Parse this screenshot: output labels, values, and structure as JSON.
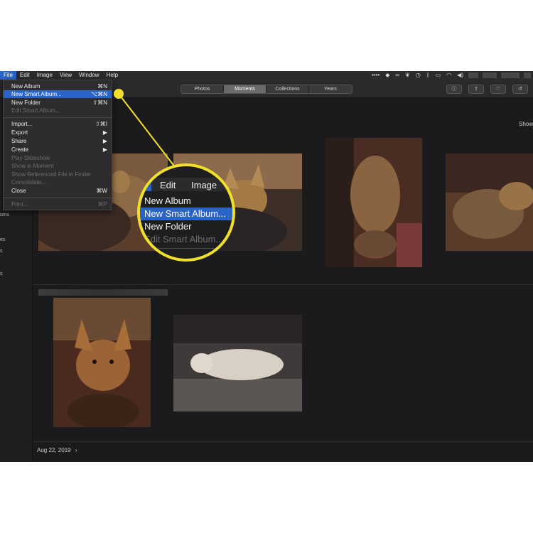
{
  "menubar": {
    "items": [
      "File",
      "Edit",
      "Image",
      "View",
      "Window",
      "Help"
    ],
    "active": "File",
    "status_icons": [
      "dots-icon",
      "dropbox-icon",
      "creative-cloud-icon",
      "evernote-icon",
      "time-machine-icon",
      "bluetooth-icon",
      "airplay-icon",
      "wifi-icon",
      "volume-icon"
    ]
  },
  "toolbar": {
    "segments": [
      "Photos",
      "Moments",
      "Collections",
      "Years"
    ],
    "selected_segment": "Moments",
    "buttons": [
      "info-icon",
      "share-icon",
      "heart-icon",
      "rotate-icon"
    ]
  },
  "file_menu": {
    "items": [
      {
        "label": "New Album",
        "shortcut": "⌘N",
        "state": "normal"
      },
      {
        "label": "New Smart Album...",
        "shortcut": "⌥⌘N",
        "state": "highlighted"
      },
      {
        "label": "New Folder",
        "shortcut": "⇧⌘N",
        "state": "normal"
      },
      {
        "label": "Edit Smart Album...",
        "shortcut": "",
        "state": "disabled"
      },
      {
        "label": "Import...",
        "shortcut": "⇧⌘I",
        "state": "normal"
      },
      {
        "label": "Export",
        "shortcut": "▶",
        "state": "normal"
      },
      {
        "label": "Share",
        "shortcut": "▶",
        "state": "normal"
      },
      {
        "label": "Create",
        "shortcut": "▶",
        "state": "normal"
      },
      {
        "label": "Play Slideshow",
        "shortcut": "",
        "state": "disabled"
      },
      {
        "label": "Show in Moment",
        "shortcut": "",
        "state": "disabled"
      },
      {
        "label": "Show Referenced File in Finder",
        "shortcut": "",
        "state": "disabled"
      },
      {
        "label": "Consolidate...",
        "shortcut": "",
        "state": "disabled"
      },
      {
        "label": "Close",
        "shortcut": "⌘W",
        "state": "normal"
      },
      {
        "label": "Print...",
        "shortcut": "⌘P",
        "state": "disabled"
      }
    ]
  },
  "magnifier": {
    "bar": [
      "Edit",
      "Image"
    ],
    "items": [
      {
        "label": "New Album",
        "state": "normal"
      },
      {
        "label": "New Smart Album...",
        "state": "highlighted"
      },
      {
        "label": "New Folder",
        "state": "normal"
      },
      {
        "label": "Edit Smart Album...",
        "state": "disabled"
      }
    ]
  },
  "sidebar": {
    "fragments": [
      "ums",
      "es",
      "s",
      "s"
    ]
  },
  "content": {
    "show_link": "Show",
    "date_label": "Aug 22, 2019",
    "date_chevron": "›"
  },
  "colors": {
    "accent": "#2a64c9",
    "callout": "#f0e02a",
    "background": "#1b1b1d"
  }
}
